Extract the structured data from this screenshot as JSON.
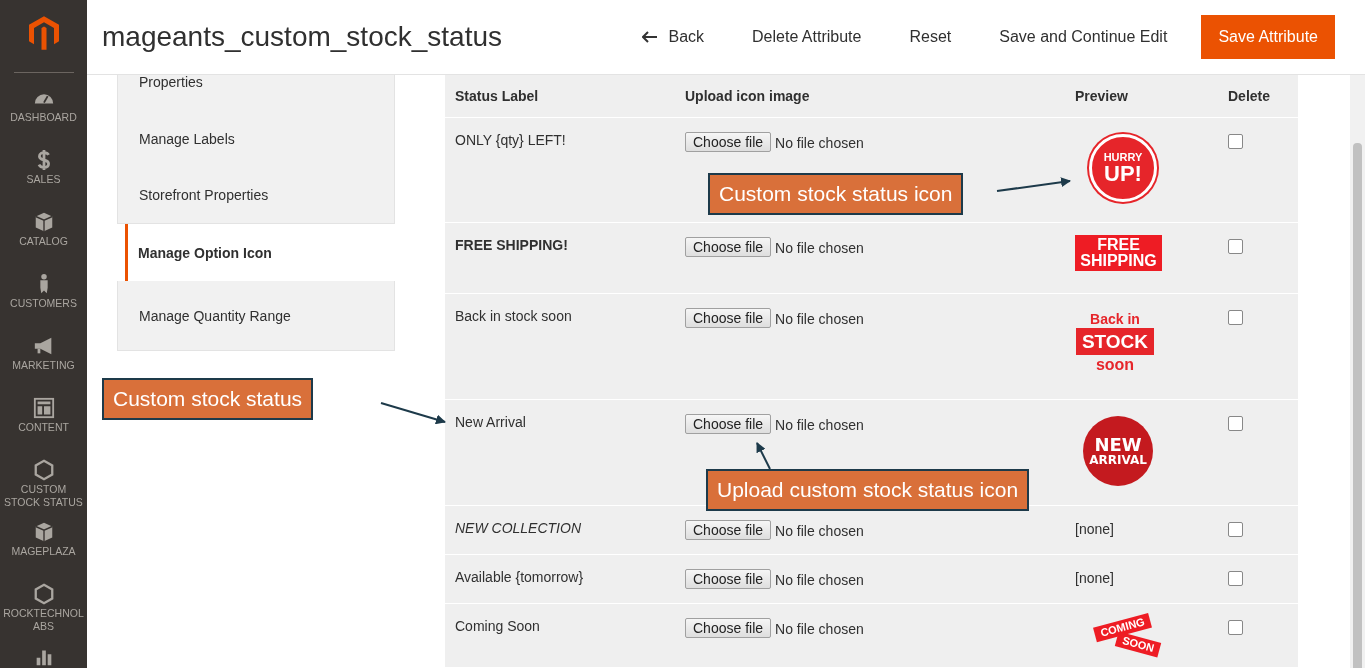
{
  "sidebar": {
    "items": [
      {
        "label": "DASHBOARD",
        "selected": false
      },
      {
        "label": "SALES",
        "selected": false
      },
      {
        "label": "CATALOG",
        "selected": false
      },
      {
        "label": "CUSTOMERS",
        "selected": false
      },
      {
        "label": "MARKETING",
        "selected": false
      },
      {
        "label": "CONTENT",
        "selected": false
      },
      {
        "label": "CUSTOM STOCK STATUS",
        "selected": false
      },
      {
        "label": "MAGEPLAZA",
        "selected": false
      },
      {
        "label": "ROCKTECHNOL ABS",
        "selected": false
      },
      {
        "selected": false
      }
    ]
  },
  "header": {
    "title": "mageants_custom_stock_status",
    "buttons": [
      {
        "label": "Back",
        "kind": "back"
      },
      {
        "label": "Delete Attribute",
        "kind": "plain"
      },
      {
        "label": "Reset",
        "kind": "plain"
      },
      {
        "label": "Save and Continue Edit",
        "kind": "plain"
      },
      {
        "label": "Save Attribute",
        "kind": "primary"
      }
    ]
  },
  "tabs": [
    {
      "label": "Properties",
      "selected": false
    },
    {
      "label": "Manage Labels",
      "selected": false
    },
    {
      "label": "Storefront Properties",
      "selected": false
    },
    {
      "label": "Manage Option Icon",
      "selected": true
    },
    {
      "label": "Manage Quantity Range",
      "selected": false
    }
  ],
  "table": {
    "columns": [
      "Status Label",
      "Upload icon image",
      "Preview",
      "Delete"
    ],
    "rows": [
      {
        "label": "ONLY {qty} LEFT!",
        "kind": "plain",
        "button": "Choose file",
        "file": "No file chosen",
        "preview": {
          "kind": "alarm",
          "lines": [
            "HURRY",
            "UP!"
          ]
        },
        "checked": false
      },
      {
        "label": "FREE SHIPPING!",
        "kind": "bold",
        "button": "Choose file",
        "file": "No file chosen",
        "preview": {
          "kind": "banner",
          "lines": [
            "FREE",
            "SHIPPING"
          ]
        },
        "checked": false
      },
      {
        "label": "Back in stock soon",
        "kind": "plain",
        "button": "Choose file",
        "file": "No file chosen",
        "preview": {
          "kind": "stock",
          "lines": [
            "Back in",
            "STOCK",
            "soon"
          ]
        },
        "checked": false
      },
      {
        "label": "New Arrival",
        "kind": "plain",
        "button": "Choose file",
        "file": "No file chosen",
        "preview": {
          "kind": "seal",
          "lines": [
            "NEW",
            "ARRIVAL"
          ]
        },
        "checked": false
      },
      {
        "label": "NEW COLLECTION",
        "kind": "italic",
        "button": "Choose file",
        "file": "No file chosen",
        "preview": {
          "kind": "none",
          "lines": [
            "[none]"
          ]
        },
        "checked": false
      },
      {
        "label": "Available {tomorrow}",
        "kind": "plain",
        "button": "Choose file",
        "file": "No file chosen",
        "preview": {
          "kind": "none",
          "lines": [
            "[none]"
          ]
        },
        "checked": false
      },
      {
        "label": "Coming Soon",
        "kind": "plain",
        "button": "Choose file",
        "file": "No file chosen",
        "preview": {
          "kind": "ribbon",
          "lines": [
            "COMING",
            "SOON"
          ]
        },
        "checked": false
      }
    ]
  },
  "callouts": [
    "Custom stock status icon",
    "Custom stock status",
    "Upload custom stock status icon"
  ]
}
